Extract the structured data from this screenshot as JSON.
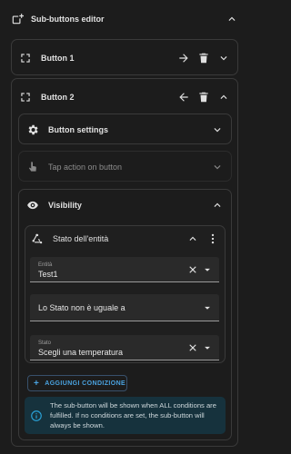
{
  "editor": {
    "title": "Sub-buttons editor"
  },
  "buttons": [
    {
      "label": "Button 1"
    },
    {
      "label": "Button 2"
    }
  ],
  "sections": {
    "button_settings": "Button settings",
    "tap_action": "Tap action on button",
    "visibility": "Visibility"
  },
  "condition": {
    "title": "Stato dell'entità",
    "entity_label": "Entità",
    "entity_value": "Test1",
    "operator_value": "Lo Stato non è uguale a",
    "state_label": "Stato",
    "state_value": "Scegli una temperatura"
  },
  "add_condition": "AGGIUNGI CONDIZIONE",
  "info_text": "The sub-button will be shown when ALL conditions are fulfilled. If no conditions are set, the sub-button will always be shown.",
  "colors": {
    "accent": "#4aa3e0",
    "info_bg": "#16323d",
    "info_icon": "#2aa1d6"
  }
}
